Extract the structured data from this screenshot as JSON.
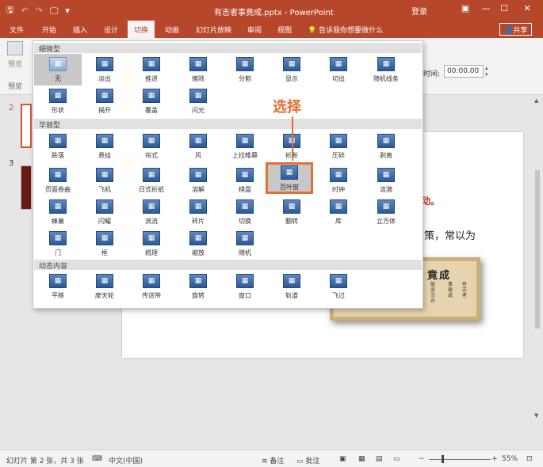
{
  "titlebar": {
    "qat": [
      "🖫",
      "↶",
      "↷",
      "🖵",
      "▾"
    ],
    "title": "有志者事竟成.pptx  -  PowerPoint",
    "login": "登录",
    "buttons": [
      "▣",
      "—",
      "☐",
      "✕"
    ]
  },
  "tabs": {
    "items": [
      "文件",
      "开始",
      "插入",
      "设计",
      "切换",
      "动画",
      "幻灯片放映",
      "审阅",
      "视图"
    ],
    "active_index": 4,
    "tell_me": "告诉我你想要做什么",
    "share": "共享"
  },
  "ribbon": {
    "preview_label": "预览",
    "group_label": "预览",
    "time_label": "时间:",
    "time_value": "00:00.00"
  },
  "thumbnails": {
    "numbers": [
      "2",
      "3"
    ]
  },
  "slide": {
    "red_text": "动。",
    "body_text": "策，常以为",
    "seal_title": "竟成",
    "seal_cols": [
      "有志者",
      "事竟成",
      "破釜沉舟"
    ]
  },
  "gallery": {
    "categories": [
      "细微型",
      "华丽型",
      "动态内容"
    ],
    "subtle": [
      "无",
      "淡出",
      "推进",
      "擦除",
      "分割",
      "显示",
      "切出",
      "随机线条",
      "形状",
      "揭开",
      "覆盖",
      "闪光"
    ],
    "exciting": [
      "跌落",
      "悬挂",
      "帘式",
      "风",
      "上拉帷幕",
      "折断",
      "压碎",
      "剥离",
      "页面卷曲",
      "飞机",
      "日式折纸",
      "溶解",
      "棋盘",
      "百叶窗",
      "时钟",
      "涟漪",
      "蜂巢",
      "闪耀",
      "涡流",
      "碎片",
      "切换",
      "翻转",
      "库",
      "立方体",
      "门",
      "框",
      "梳理",
      "缩放",
      "随机"
    ],
    "dynamic": [
      "平移",
      "摩天轮",
      "传送带",
      "旋转",
      "窗口",
      "轨道",
      "飞过"
    ],
    "selected_label": "百叶窗"
  },
  "annotation": {
    "text": "选择"
  },
  "statusbar": {
    "slide_info": "幻灯片 第 2 张，共 3 张",
    "language": "中文(中国)",
    "notes": "备注",
    "comments": "批注",
    "zoom": "55%",
    "minus": "−",
    "plus": "+"
  }
}
